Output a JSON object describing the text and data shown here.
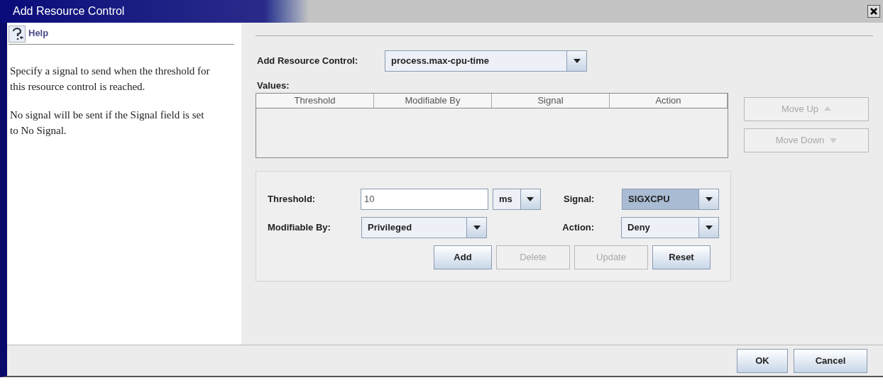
{
  "window": {
    "title": "Add Resource Control"
  },
  "help": {
    "title": "Help",
    "paragraphs": [
      "Specify a signal to send when the threshold for this resource control is reached.",
      "No signal will be sent if the Signal field is set to No Signal."
    ]
  },
  "resource_control": {
    "label": "Add Resource Control:",
    "value": "process.max-cpu-time"
  },
  "values": {
    "label": "Values:",
    "columns": [
      "Threshold",
      "Modifiable By",
      "Signal",
      "Action"
    ],
    "buttons": [
      {
        "label": "Move Up",
        "kind": "up",
        "disabled": true
      },
      {
        "label": "Move Down",
        "kind": "down",
        "disabled": true
      }
    ]
  },
  "form": {
    "threshold": {
      "label": "Threshold:",
      "value": "10",
      "unit": "ms"
    },
    "signal": {
      "label": "Signal:",
      "value": "SIGXCPU",
      "focused": true
    },
    "modifiable_by": {
      "label": "Modifiable By:",
      "value": "Privileged"
    },
    "action": {
      "label": "Action:",
      "value": "Deny"
    },
    "buttons": [
      {
        "label": "Add",
        "disabled": false
      },
      {
        "label": "Delete",
        "disabled": true
      },
      {
        "label": "Update",
        "disabled": true
      },
      {
        "label": "Reset",
        "disabled": false
      }
    ]
  },
  "footer": {
    "buttons": [
      {
        "label": "OK"
      },
      {
        "label": "Cancel"
      }
    ]
  }
}
